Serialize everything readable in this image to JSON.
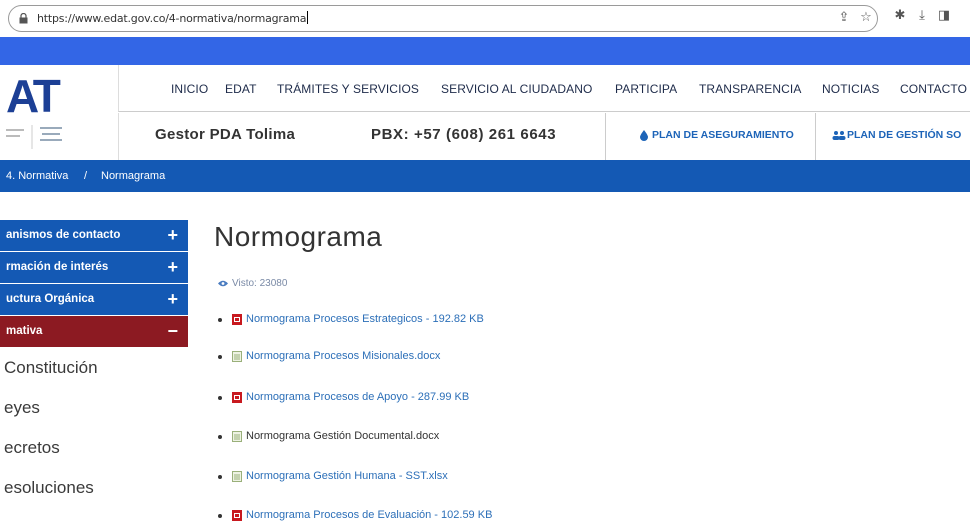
{
  "browser": {
    "url": "https://www.edat.gov.co/4-normativa/normagrama"
  },
  "header": {
    "logo_text": "AT",
    "nav": [
      "INICIO",
      "EDAT",
      "TRÁMITES Y SERVICIOS",
      "SERVICIO AL CIUDADANO",
      "PARTICIPA",
      "TRANSPARENCIA",
      "NOTICIAS",
      "CONTACTO"
    ],
    "gestor": "Gestor PDA Tolima",
    "pbx": "PBX: +57 (608) 261 6643",
    "plan1": "PLAN DE ASEGURAMIENTO",
    "plan2": "PLAN DE GESTIÓN SO"
  },
  "breadcrumb": {
    "item1": "4. Normativa",
    "separator": "/",
    "item2": "Normagrama"
  },
  "sidebar": {
    "sections": [
      {
        "label": "anismos de contacto",
        "toggle": "+"
      },
      {
        "label": "rmación de interés",
        "toggle": "+"
      },
      {
        "label": "uctura Orgánica",
        "toggle": "+"
      },
      {
        "label": "mativa",
        "toggle": "−"
      }
    ],
    "subitems": [
      "Constitución",
      "eyes",
      "ecretos",
      "esoluciones"
    ]
  },
  "main": {
    "title": "Normograma",
    "views": "Visto: 23080",
    "documents": [
      {
        "label": "Normograma Procesos Estrategicos - 192.82 KB",
        "type": "pdf"
      },
      {
        "label": "Normograma Procesos Misionales.docx",
        "type": "doc"
      },
      {
        "label": "Normograma Procesos de Apoyo - 287.99 KB",
        "type": "pdf"
      },
      {
        "label": "Normograma Gestión Documental.docx",
        "type": "doc"
      },
      {
        "label": "Normograma Gestión Humana - SST.xlsx",
        "type": "doc"
      },
      {
        "label": "Normograma Procesos de Evaluación - 102.59 KB",
        "type": "pdf"
      }
    ]
  },
  "colors": {
    "top_strip": "#3366e6",
    "brand_blue": "#1459b4",
    "active_red": "#8c1a22",
    "link": "#2c6fb8"
  }
}
